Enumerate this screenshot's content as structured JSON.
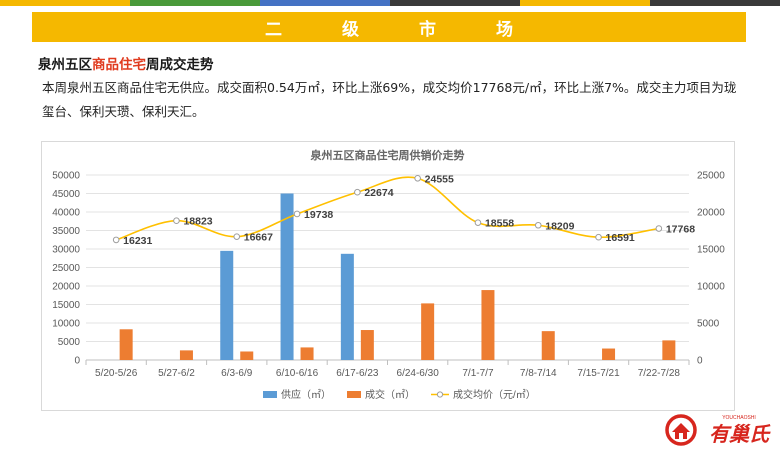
{
  "colors": {
    "banner": "#f5b800",
    "highlight": "#e03a1e",
    "supply": "#5b9bd5",
    "deal": "#ed7d31",
    "price": "#ffc000",
    "stripe": [
      "#f5b800",
      "#4a9a3a",
      "#4472c4",
      "#3a3a3a",
      "#f5b800",
      "#3a3a3a"
    ]
  },
  "banner": {
    "title": "二级市场"
  },
  "headline": {
    "prefix": "泉州五区",
    "highlight": "商品住宅",
    "suffix": "周成交走势"
  },
  "paragraph": "本周泉州五区商品住宅无供应。成交面积0.54万㎡，环比上涨69%，成交均价17768元/㎡，环比上涨7%。成交主力项目为珑玺台、保利天瓒、保利天汇。",
  "logo": {
    "text": "有巢氏",
    "subtext": "YOUCHAOSHI",
    "icon": "house-logo-icon"
  },
  "chart_data": {
    "type": "bar",
    "title": "泉州五区商品住宅周供销价走势",
    "categories": [
      "5/20-5/26",
      "5/27-6/2",
      "6/3-6/9",
      "6/10-6/16",
      "6/17-6/23",
      "6/24-6/30",
      "7/1-7/7",
      "7/8-7/14",
      "7/15-7/21",
      "7/22-7/28"
    ],
    "series": [
      {
        "name": "供应（㎡）",
        "type": "bar",
        "axis": "left",
        "values": [
          0,
          0,
          29500,
          45000,
          28700,
          0,
          0,
          0,
          0,
          0
        ]
      },
      {
        "name": "成交（㎡）",
        "type": "bar",
        "axis": "left",
        "values": [
          8300,
          2600,
          2300,
          3400,
          8100,
          15300,
          18900,
          7800,
          3100,
          5300
        ]
      },
      {
        "name": "成交均价（元/㎡）",
        "type": "line",
        "axis": "right",
        "values": [
          16231,
          18823,
          16667,
          19738,
          22674,
          24555,
          18558,
          18209,
          16591,
          17768
        ]
      }
    ],
    "left_axis": {
      "min": 0,
      "max": 50000,
      "step": 5000,
      "ticks": [
        "0",
        "5000",
        "10000",
        "15000",
        "20000",
        "25000",
        "30000",
        "35000",
        "40000",
        "45000",
        "50000"
      ]
    },
    "right_axis": {
      "min": 0,
      "max": 25000,
      "step": 5000,
      "ticks": [
        "0",
        "5000",
        "10000",
        "15000",
        "20000",
        "25000"
      ]
    },
    "legend_position": "bottom",
    "grid": true
  }
}
